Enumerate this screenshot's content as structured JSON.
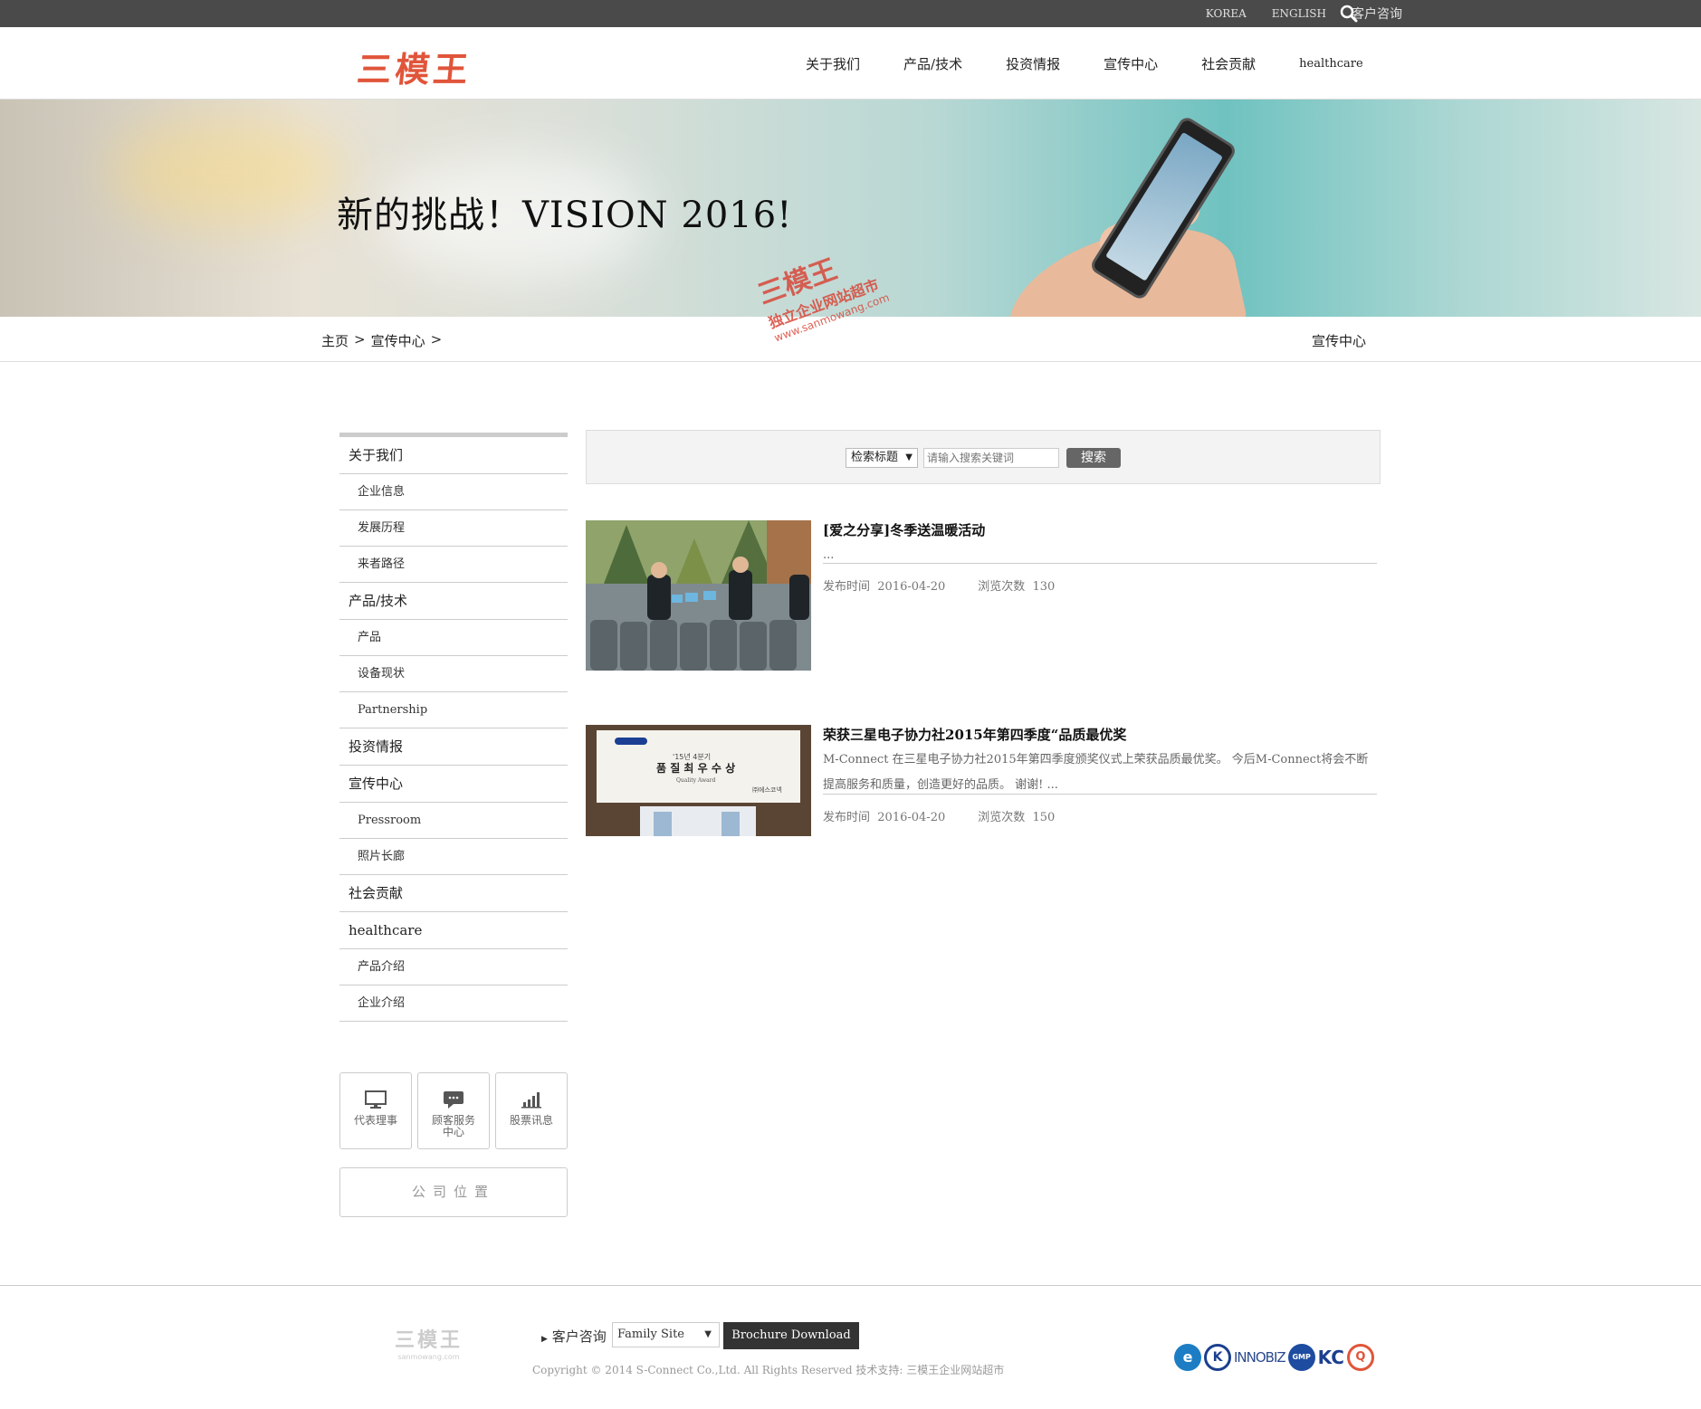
{
  "topbar": {
    "korea": "KOREA",
    "english": "ENGLISH",
    "contact": "客户咨询"
  },
  "header": {
    "logo": "三模王",
    "nav": [
      "关于我们",
      "产品/技术",
      "投资情报",
      "宣传中心",
      "社会贡献",
      "healthcare"
    ]
  },
  "banner": {
    "title": "新的挑战！VISION 2016!",
    "watermark": {
      "main": "三模王",
      "sub": "独立企业网站超市",
      "url": "www.sanmowang.com"
    }
  },
  "breadcrumb": {
    "items": [
      "主页",
      "宣传中心"
    ],
    "current": "宣传中心"
  },
  "sidebar": {
    "items": [
      {
        "label": "关于我们",
        "level": 1
      },
      {
        "label": "企业信息",
        "level": 2
      },
      {
        "label": "发展历程",
        "level": 2
      },
      {
        "label": "来者路径",
        "level": 2
      },
      {
        "label": "产品/技术",
        "level": 1
      },
      {
        "label": "产品",
        "level": 2
      },
      {
        "label": "设备现状",
        "level": 2
      },
      {
        "label": "Partnership",
        "level": 2
      },
      {
        "label": "投资情报",
        "level": 1
      },
      {
        "label": "宣传中心",
        "level": 1
      },
      {
        "label": "Pressroom",
        "level": 2
      },
      {
        "label": "照片长廊",
        "level": 2
      },
      {
        "label": "社会贡献",
        "level": 1
      },
      {
        "label": "healthcare",
        "level": 1
      },
      {
        "label": "产品介绍",
        "level": 2
      },
      {
        "label": "企业介绍",
        "level": 2
      }
    ],
    "quick": [
      {
        "label": "代表理事",
        "icon": "monitor-icon"
      },
      {
        "label": "顾客服务中心",
        "icon": "chat-icon"
      },
      {
        "label": "股票讯息",
        "icon": "bar-chart-icon"
      }
    ],
    "company_location": "公司位置"
  },
  "search": {
    "select": "检索标题",
    "placeholder": "请输入搜索关键词",
    "button": "搜索"
  },
  "posts": [
    {
      "title": "[爱之分享]冬季送温暖活动",
      "excerpt": "...",
      "date_label": "发布时间",
      "date": "2016-04-20",
      "views_label": "浏览次数",
      "views": "130"
    },
    {
      "title": "荣获三星电子协力社2015年第四季度“品质最优奖",
      "excerpt": "M-Connect 在三星电子协力社2015年第四季度颁奖仪式上荣获品质最优奖。 今后M-Connect将会不断提高服务和质量，创造更好的品质。 谢谢! ...",
      "date_label": "发布时间",
      "date": "2016-04-20",
      "views_label": "浏览次数",
      "views": "150",
      "plaque": {
        "line1": "'15년 4분기",
        "line2": "품 질 최 우 수 상",
        "line3": "Quality Award",
        "line4": "㈜에스코넥"
      }
    }
  ],
  "footer": {
    "logo": "三模王",
    "logo_sub": "sanmowang.com",
    "contact": "客户咨询",
    "family_site": "Family Site",
    "brochure": "Brochure Download",
    "copyright": "Copyright © 2014 S-Connect Co.,Ltd. All Rights Reserved 技术支持: 三模王企业网站超市",
    "certs": [
      "e",
      "K",
      "INNOBIZ",
      "GMP",
      "KC",
      "Q"
    ]
  },
  "colors": {
    "topbar": "#4a4a4a",
    "logo": "#e0553a",
    "button": "#666666",
    "footer_button": "#333333"
  }
}
